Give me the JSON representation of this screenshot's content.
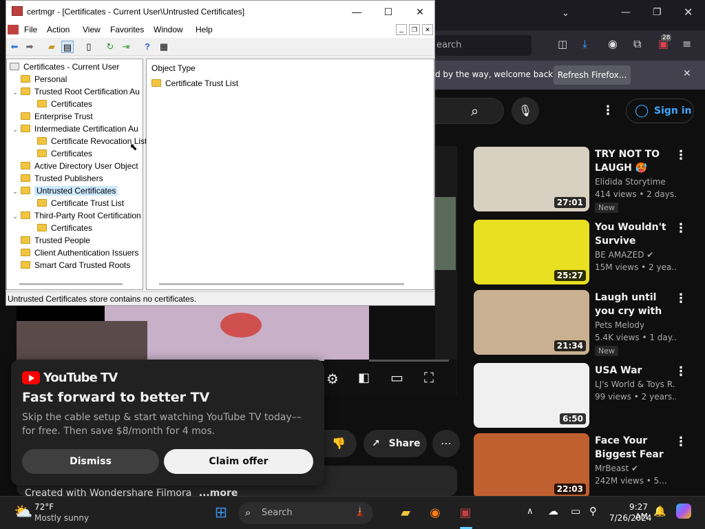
{
  "certmgr": {
    "title": "certmgr - [Certificates - Current User\\Untrusted Certificates]",
    "menus": [
      "File",
      "Action",
      "View",
      "Favorites",
      "Window",
      "Help"
    ],
    "tree": [
      {
        "label": "Certificates - Current User",
        "level": 0,
        "exp": "",
        "icon": "root"
      },
      {
        "label": "Personal",
        "level": 1,
        "exp": ""
      },
      {
        "label": "Trusted Root Certification Au",
        "level": 1,
        "exp": "v"
      },
      {
        "label": "Certificates",
        "level": 2,
        "exp": ""
      },
      {
        "label": "Enterprise Trust",
        "level": 1,
        "exp": ""
      },
      {
        "label": "Intermediate Certification Au",
        "level": 1,
        "exp": "v"
      },
      {
        "label": "Certificate Revocation List",
        "level": 2,
        "exp": ""
      },
      {
        "label": "Certificates",
        "level": 2,
        "exp": ""
      },
      {
        "label": "Active Directory User Object",
        "level": 1,
        "exp": ""
      },
      {
        "label": "Trusted Publishers",
        "level": 1,
        "exp": ""
      },
      {
        "label": "Untrusted Certificates",
        "level": 1,
        "exp": "v",
        "selected": true
      },
      {
        "label": "Certificate Trust List",
        "level": 2,
        "exp": ""
      },
      {
        "label": "Third-Party Root Certification",
        "level": 1,
        "exp": "v"
      },
      {
        "label": "Certificates",
        "level": 2,
        "exp": ""
      },
      {
        "label": "Trusted People",
        "level": 1,
        "exp": ""
      },
      {
        "label": "Client Authentication Issuers",
        "level": 1,
        "exp": ""
      },
      {
        "label": "Smart Card Trusted Roots",
        "level": 1,
        "exp": ""
      }
    ],
    "list_header": "Object Type",
    "list_items": [
      "Certificate Trust List"
    ],
    "status": "Untrusted Certificates store contains no certificates."
  },
  "firefox": {
    "url_fragment": "earch",
    "notification": "d by the way, welcome back!",
    "refresh_label": "Refresh Firefox...",
    "extension_badge": "28"
  },
  "youtube": {
    "signin_label": "Sign in",
    "videos": [
      {
        "title": "TRY NOT TO LAUGH 🥵 Best...",
        "channel": "Elidida Storytime",
        "meta": "414 views • 2 days...",
        "duration": "27:01",
        "new": true,
        "badge": "New",
        "verified": false
      },
      {
        "title": "You Wouldn't Survive Dipping...",
        "channel": "BE AMAZED",
        "meta": "15M views • 2 yea...",
        "duration": "25:27",
        "new": false,
        "verified": true
      },
      {
        "title": "Laugh until you cry with these...",
        "channel": "Pets Melody",
        "meta": "5.4K views • 1 day...",
        "duration": "21:34",
        "new": true,
        "badge": "New",
        "verified": false
      },
      {
        "title": "USA War",
        "channel": "LJ's World & Toys R...",
        "meta": "99 views • 2 years...",
        "duration": "6:50",
        "new": false,
        "verified": false
      },
      {
        "title": "Face Your Biggest Fear To...",
        "channel": "MrBeast",
        "meta": "242M views • 5...",
        "duration": "22:03",
        "new": false,
        "verified": true
      }
    ],
    "share_label": "Share",
    "description_snippet": "Created with Wondershare Filmora",
    "more_label": "...more",
    "promo": {
      "logo": "YouTube TV",
      "headline": "Fast forward to better TV",
      "body": "Skip the cable setup & start watching YouTube TV today–– for free. Then save $8/month for 4 mos.",
      "dismiss": "Dismiss",
      "claim": "Claim offer"
    }
  },
  "taskbar": {
    "weather_temp": "72°F",
    "weather_desc": "Mostly sunny",
    "search_placeholder": "Search",
    "time": "9:27 AM",
    "date": "7/26/2024"
  }
}
